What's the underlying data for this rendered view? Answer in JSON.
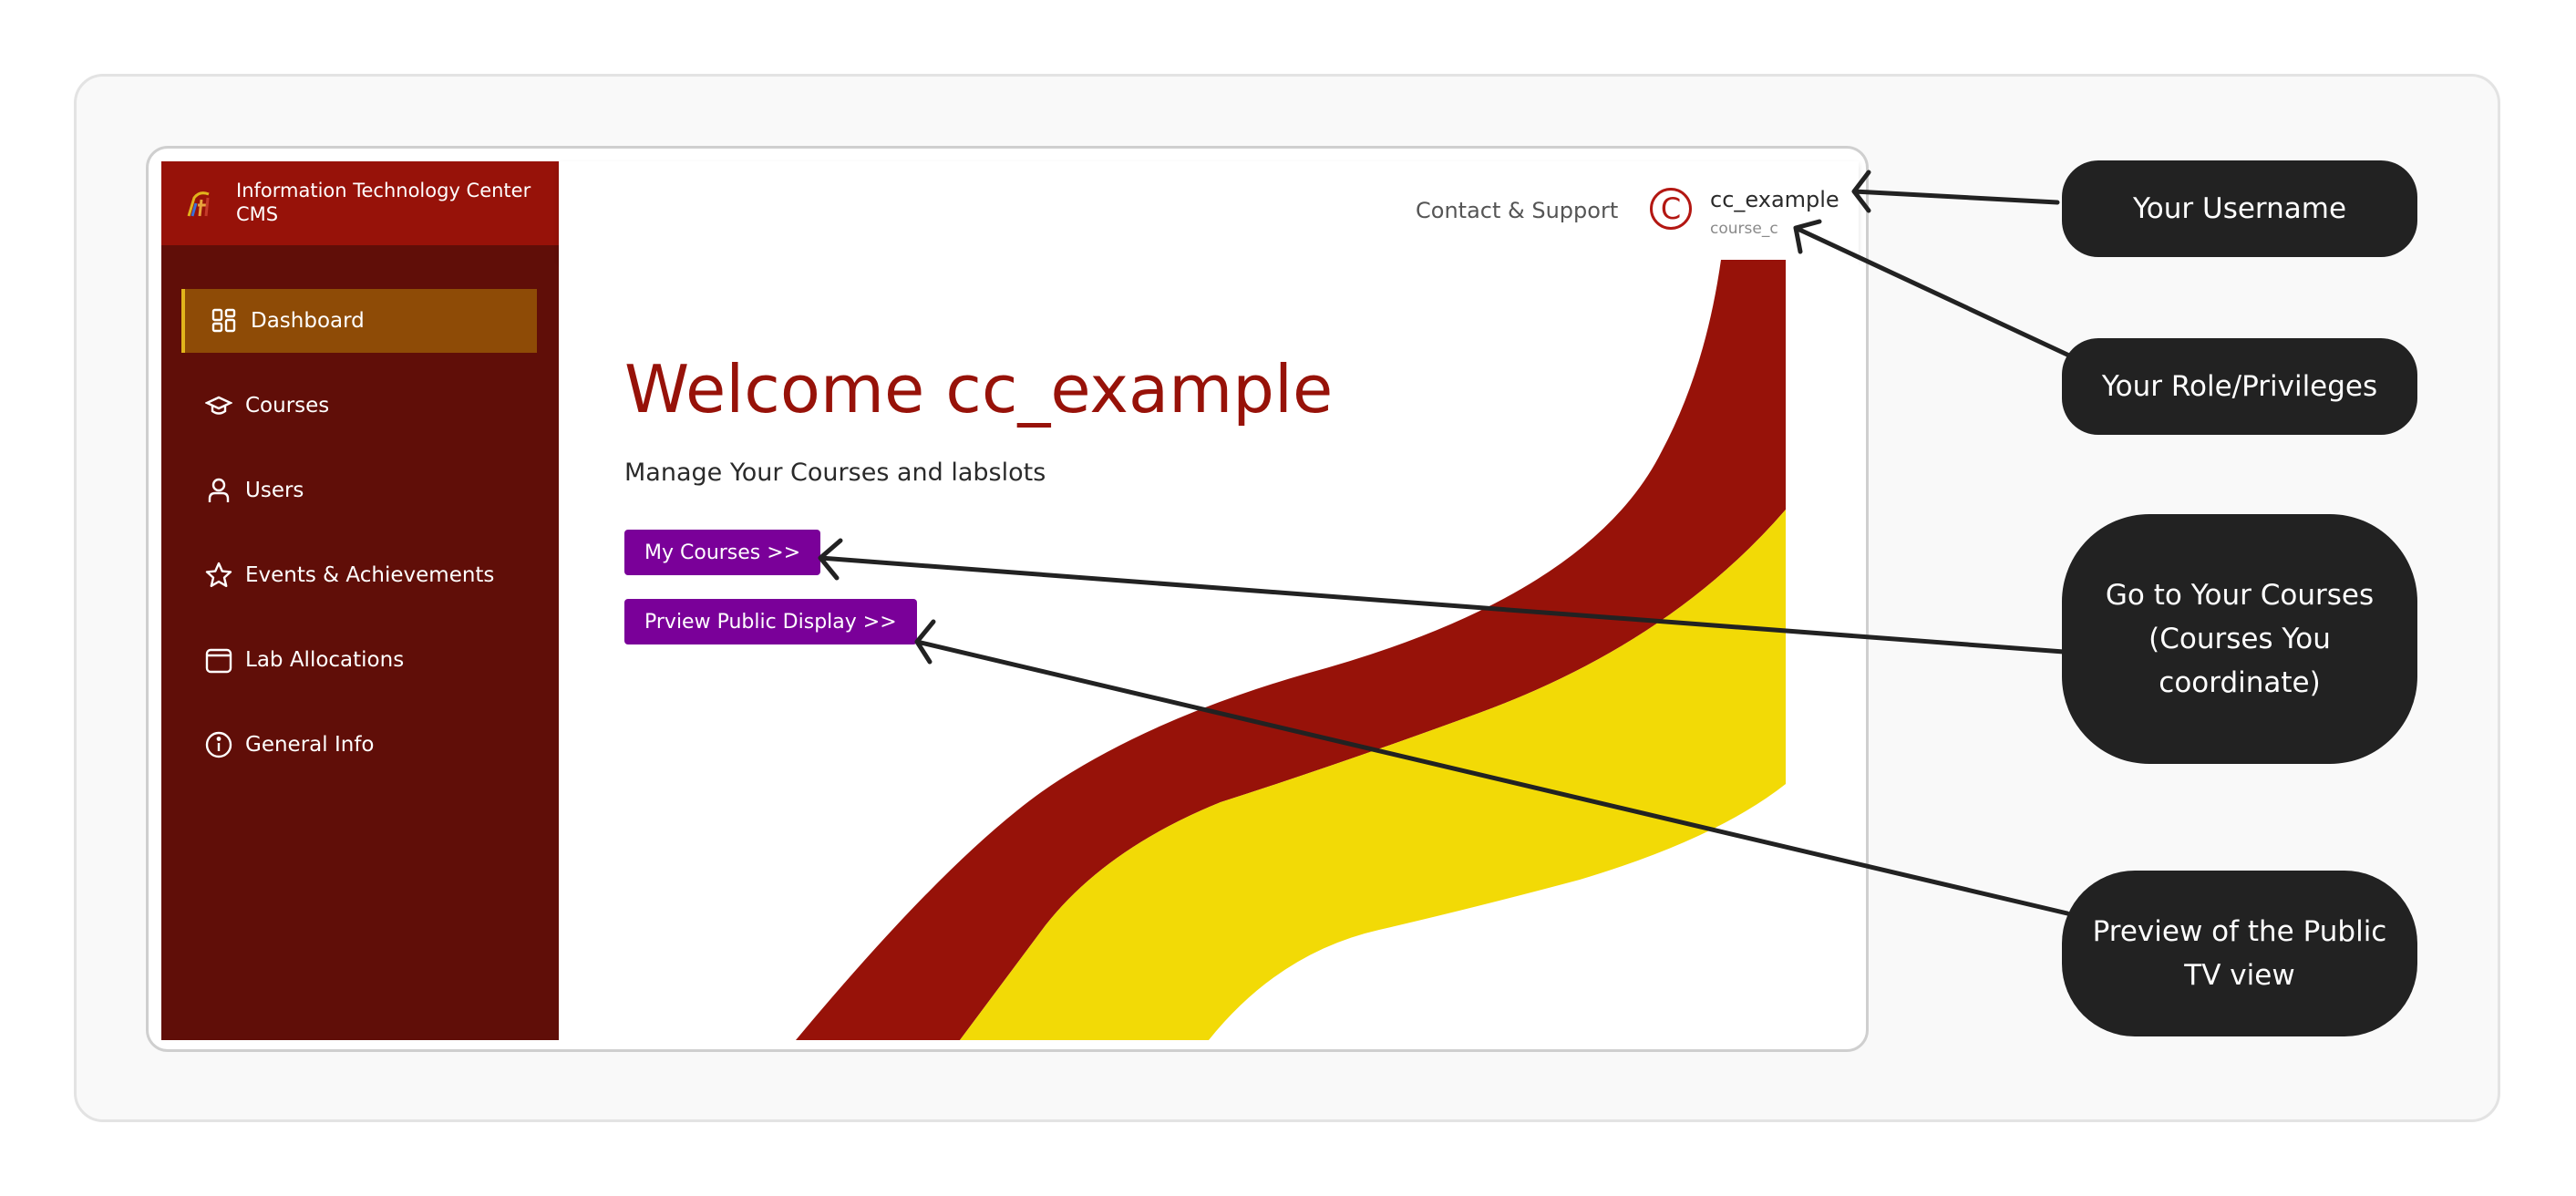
{
  "app": {
    "brand_title": "Information Technology Center CMS",
    "brand_color": "#971209",
    "sidebar_color": "#600e08",
    "active_color": "#8e4b06",
    "button_color": "#7a0099",
    "accent_yellow": "#f2da06"
  },
  "sidebar": {
    "items": [
      {
        "label": "Dashboard",
        "icon": "dashboard-grid-icon",
        "active": true
      },
      {
        "label": "Courses",
        "icon": "graduation-cap-icon",
        "active": false
      },
      {
        "label": "Users",
        "icon": "user-icon",
        "active": false
      },
      {
        "label": "Events & Achievements",
        "icon": "star-icon",
        "active": false
      },
      {
        "label": "Lab Allocations",
        "icon": "calendar-icon",
        "active": false
      },
      {
        "label": "General Info",
        "icon": "info-icon",
        "active": false
      }
    ]
  },
  "header": {
    "contact_label": "Contact & Support",
    "avatar_letter": "C",
    "username": "cc_example",
    "role": "course_c"
  },
  "main": {
    "welcome_title": "Welcome cc_example",
    "subtitle": "Manage Your Courses and labslots",
    "my_courses_button": "My Courses >>",
    "preview_button": "Prview Public Display >>"
  },
  "annotations": {
    "username": "Your Username",
    "role": "Your Role/Privileges",
    "courses": "Go to Your Courses (Courses You coordinate)",
    "preview": "Preview of the Public TV view"
  }
}
